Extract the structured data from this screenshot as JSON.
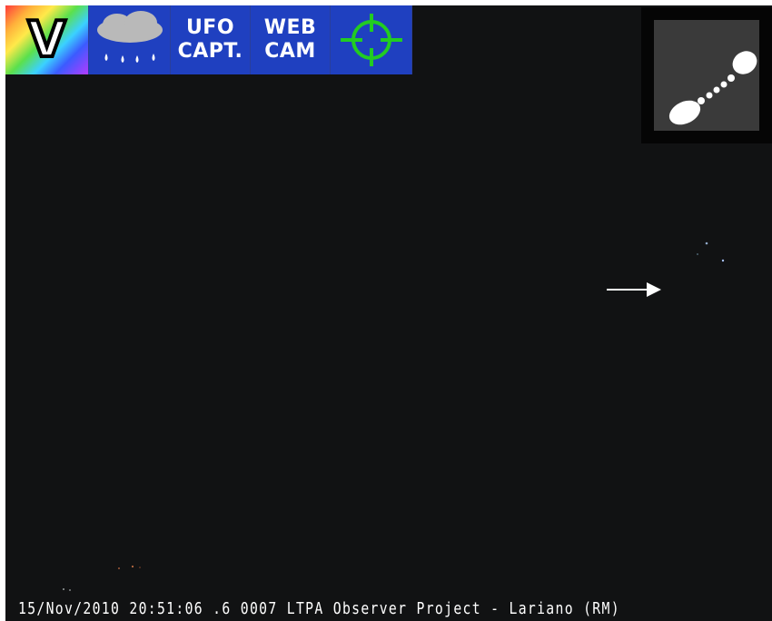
{
  "toolbar": {
    "buttons": [
      {
        "id": "v",
        "label": "V",
        "icon": "rainbow-v-icon"
      },
      {
        "id": "rain",
        "icon": "rain-cloud-icon"
      },
      {
        "id": "ufo",
        "lines": [
          "UFO",
          "CAPT."
        ]
      },
      {
        "id": "web",
        "lines": [
          "WEB",
          "CAM"
        ]
      },
      {
        "id": "target",
        "icon": "crosshair-icon"
      }
    ]
  },
  "thumbnail": {
    "icon": "meteor-trail-icon"
  },
  "annotation": {
    "icon": "arrow-right-icon",
    "color": "#ffffff"
  },
  "caption": "15/Nov/2010 20:51:06 .6 0007 LTPA Observer Project - Lariano (RM)",
  "colors": {
    "background": "#111213",
    "toolbar": "#1f40c0",
    "crosshair": "#22cc22"
  }
}
